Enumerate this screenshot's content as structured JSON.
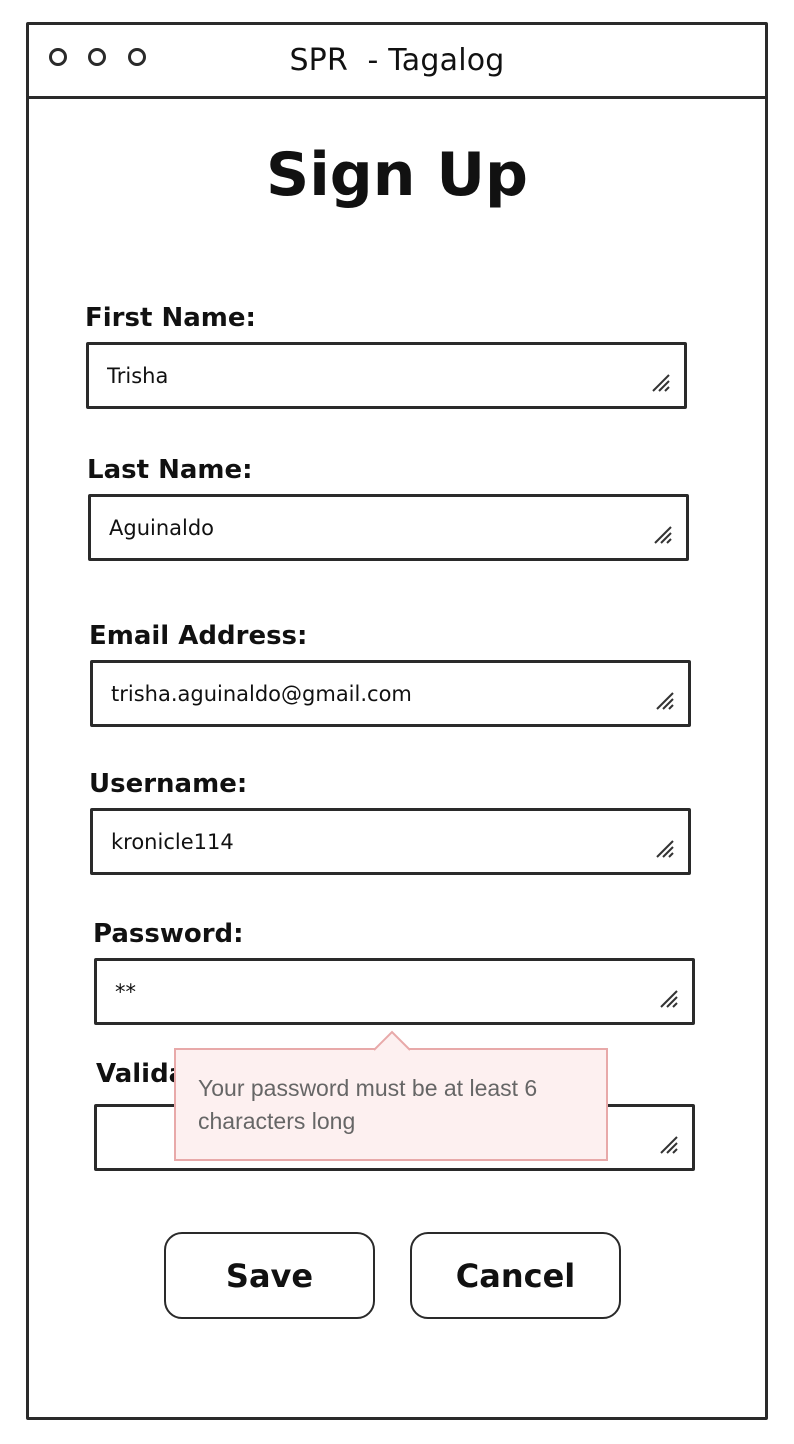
{
  "window": {
    "title": "SPR  - Tagalog"
  },
  "page": {
    "title": "Sign Up"
  },
  "form": {
    "first_name": {
      "label": "First Name:",
      "value": "Trisha"
    },
    "last_name": {
      "label": "Last Name:",
      "value": "Aguinaldo"
    },
    "email": {
      "label": "Email Address:",
      "value": "trisha.aguinaldo@gmail.com"
    },
    "username": {
      "label": "Username:",
      "value": "kronicle114"
    },
    "password": {
      "label": "Password:",
      "value": "**"
    },
    "validate_password": {
      "label": "Valida",
      "value": ""
    }
  },
  "tooltip": {
    "message": "Your password must be at least 6 characters long"
  },
  "buttons": {
    "save_label": "Save",
    "cancel_label": "Cancel"
  },
  "colors": {
    "tooltip_bg": "#fdf0f0",
    "tooltip_border": "#e8a9a9"
  }
}
